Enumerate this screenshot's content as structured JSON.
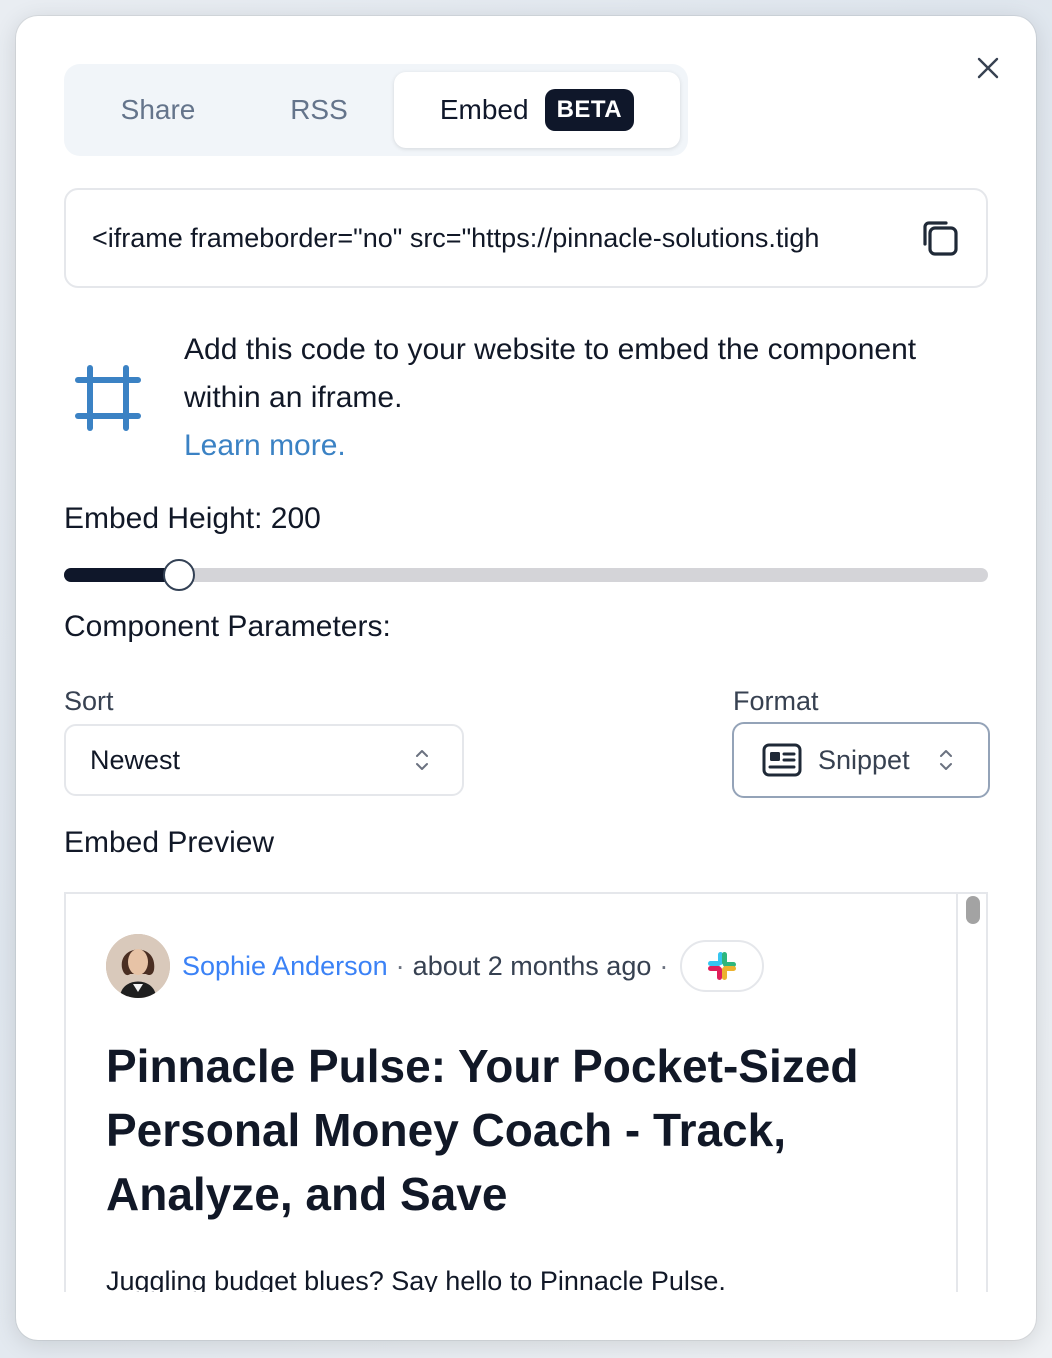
{
  "tabs": {
    "share": "Share",
    "rss": "RSS",
    "embed": "Embed",
    "badge": "BETA"
  },
  "embed_code": "<iframe frameborder=\"no\" src=\"https://pinnacle-solutions.tigh",
  "info": {
    "text": "Add this code to your website to embed the component within an iframe.",
    "link": "Learn more."
  },
  "height": {
    "label": "Embed Height: 200",
    "slider_fraction": 0.124
  },
  "params": {
    "title": "Component Parameters:",
    "sort_label": "Sort",
    "sort_value": "Newest",
    "format_label": "Format",
    "format_value": "Snippet"
  },
  "preview": {
    "title": "Embed Preview",
    "author": "Sophie Anderson",
    "sep": "·",
    "time": "about 2 months ago",
    "post_title": "Pinnacle Pulse: Your Pocket-Sized Personal Money Coach - Track, Analyze, and Save",
    "post_body": "Juggling budget blues?  Say hello to Pinnacle Pulse."
  },
  "colors": {
    "accent": "#3b82c4",
    "dark": "#0f172a",
    "link": "#3b82f6"
  }
}
